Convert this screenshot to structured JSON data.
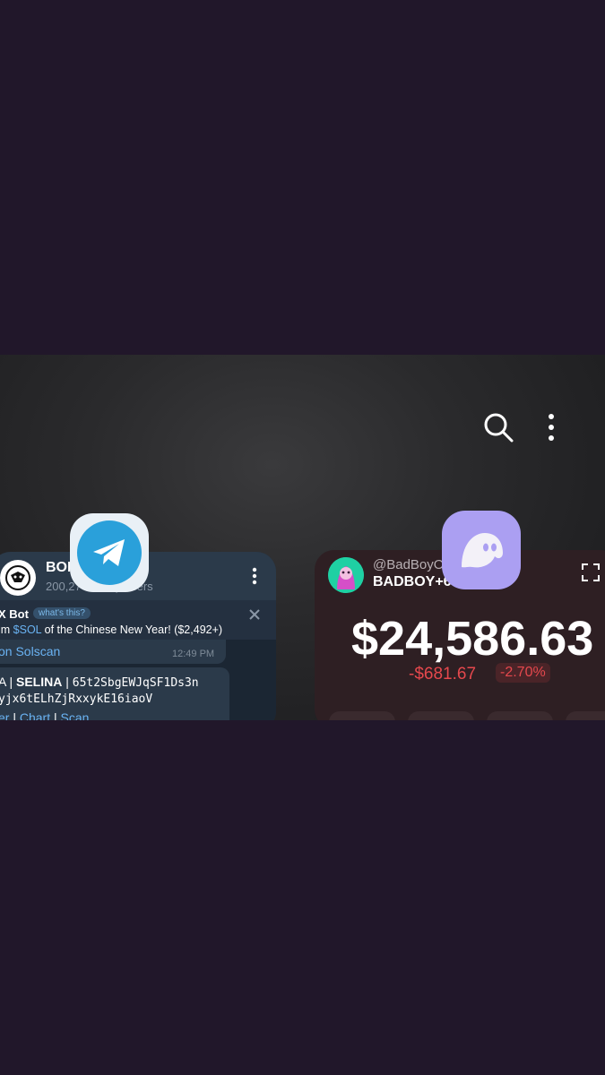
{
  "recents": {
    "search_icon": "search-icon",
    "menu_icon": "more-vert-icon"
  },
  "telegram_card": {
    "app_icon": "telegram-icon",
    "chat_title": "BON",
    "chat_subtitle": "200,27",
    "chat_subtitle_tail": "y users",
    "pinned": {
      "sender": "X Bot",
      "badge": "what's this?",
      "text_prefix": "im ",
      "text_link": "$SOL",
      "text_suffix": " of the Chinese New Year! ($2,492+)"
    },
    "message1": {
      "link": "on Solscan",
      "time": "12:49 PM"
    },
    "message2": {
      "prefix": "A | ",
      "name": "SELINA",
      "sep": " | ",
      "address1": "65t2SbgEWJqSF1Ds3n",
      "address2": "yjx6tELhZjRxxykE16iaoV",
      "link1": "er",
      "sep2": " | ",
      "link2": "Chart",
      "sep3": " | ",
      "link3": "Scan"
    }
  },
  "phantom_card": {
    "app_icon": "phantom-ghost-icon",
    "handle": "@BadBoyO",
    "account": "BADBOY+6",
    "balance": "$24,586.63",
    "change": "-$681.67",
    "change_pct": "-2.70%"
  },
  "colors": {
    "background": "#21172a",
    "telegram_blue": "#2aa0da",
    "phantom_purple": "#ab9ff2",
    "negative": "#e5484d"
  }
}
